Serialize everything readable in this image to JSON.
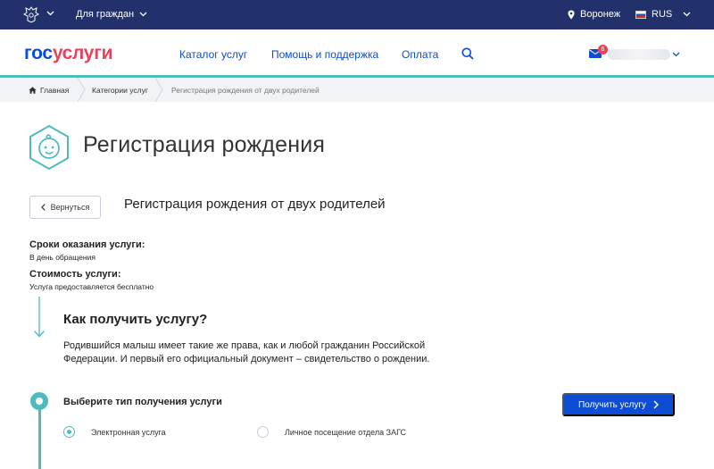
{
  "topbar": {
    "citizens_label": "Для граждан",
    "location": "Воронеж",
    "language": "RUS"
  },
  "header": {
    "logo_part1": "гос",
    "logo_part2": "услуги",
    "nav": [
      "Каталог услуг",
      "Помощь и поддержка",
      "Оплата"
    ],
    "mail_badge": "6"
  },
  "breadcrumb": {
    "items": [
      "Главная",
      "Категории услуг",
      "Регистрация рождения от двух родителей"
    ]
  },
  "page": {
    "title": "Регистрация рождения",
    "back_label": "Вернуться",
    "service_title": "Регистрация рождения от двух родителей",
    "deadline_label": "Сроки оказания услуги:",
    "deadline_value": "В день обращения",
    "cost_label": "Стоимость услуги:",
    "cost_value": "Услуга предоставляется бесплатно",
    "how_title": "Как получить услугу?",
    "how_text": "Родившийся малыш имеет такие же права, как и любой гражданин Российской Федерации. И первый его официальный документ – свидетельство о рождении.",
    "step_title": "Выберите тип получения услуги",
    "get_button": "Получить услугу",
    "options": [
      {
        "label": "Электронная услуга",
        "selected": true
      },
      {
        "label": "Личное посещение отдела ЗАГС",
        "selected": false
      }
    ]
  },
  "colors": {
    "topbar": "#22316c",
    "brand_blue": "#0d4cd3",
    "brand_red": "#ee3f58",
    "accent_teal": "#4ebcbc"
  }
}
